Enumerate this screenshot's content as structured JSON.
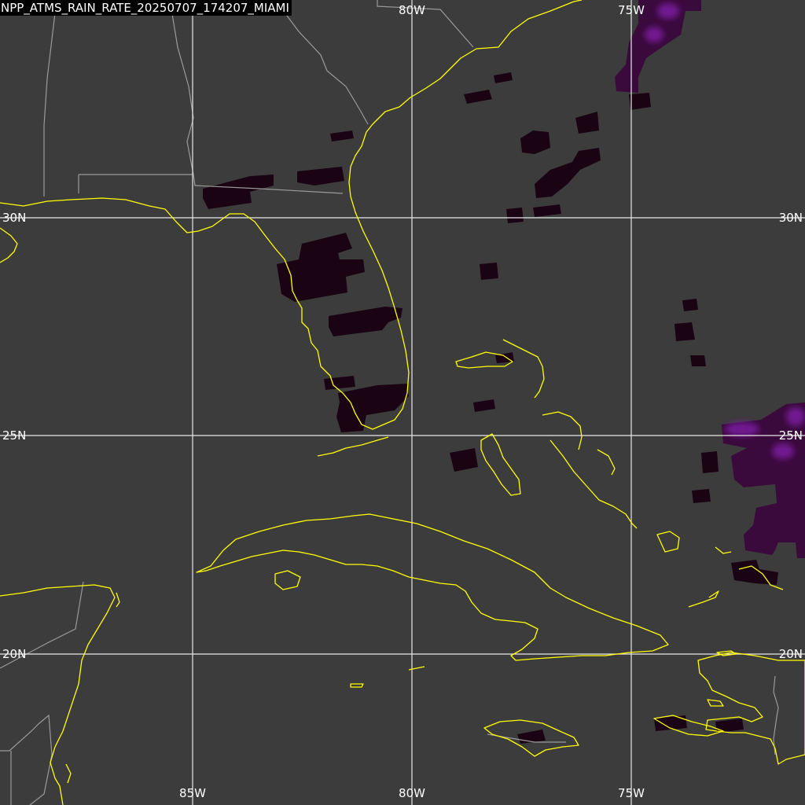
{
  "title": "NPP_ATMS_RAIN_RATE_20250707_174207_MIAMI",
  "colors": {
    "background": "#3c3c3c",
    "coastline": "#ffff00",
    "political_border": "#9a9a9a",
    "grid": "#ffffff",
    "rain_light": "#1a0414",
    "rain_medium": "#3a0a3c",
    "rain_heavy": "#7a1ea0"
  },
  "grid": {
    "longitudes": [
      {
        "lon": -85,
        "label": "85W"
      },
      {
        "lon": -80,
        "label": "80W"
      },
      {
        "lon": -75,
        "label": "75W"
      }
    ],
    "latitudes": [
      {
        "lat": 30,
        "label": "30N"
      },
      {
        "lat": 25,
        "label": "25N"
      },
      {
        "lat": 20,
        "label": "20N"
      }
    ],
    "top_labels": [
      "80W",
      "75W"
    ],
    "bottom_labels": [
      "85W",
      "80W",
      "75W"
    ],
    "left_labels": [
      "30N",
      "25N",
      "20N"
    ],
    "right_labels": [
      "30N",
      "25N",
      "20N"
    ]
  },
  "rain_legend": [
    "rain-rate-light",
    "rain-rate-medium",
    "rain-rate-heavy"
  ]
}
